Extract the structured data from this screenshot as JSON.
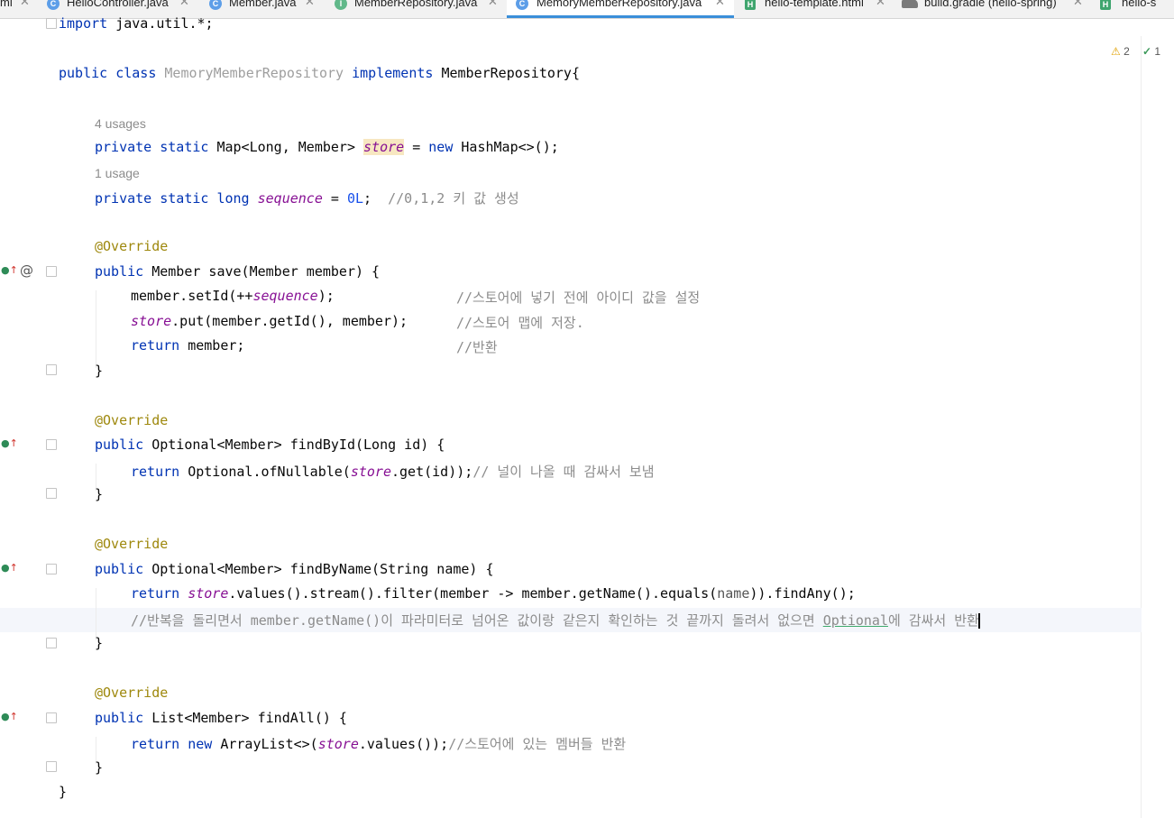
{
  "tabs": [
    {
      "label": "ml",
      "icon": "xml-file-icon",
      "active": false
    },
    {
      "label": "HelloController.java",
      "icon": "class-icon",
      "active": false
    },
    {
      "label": "Member.java",
      "icon": "class-icon",
      "active": false
    },
    {
      "label": "MemberRepository.java",
      "icon": "interface-icon",
      "active": false
    },
    {
      "label": "MemoryMemberRepository.java",
      "icon": "class-icon",
      "active": true
    },
    {
      "label": "hello-template.html",
      "icon": "html-file-icon",
      "active": false
    },
    {
      "label": "build.gradle (hello-spring)",
      "icon": "gradle-icon",
      "active": false
    },
    {
      "label": "hello-s",
      "icon": "html-file-icon",
      "active": false
    }
  ],
  "inspections": {
    "warnings": "2",
    "ok": "1"
  },
  "code": {
    "import": {
      "kw": "import",
      "rest": " java.util.*;"
    },
    "class_decl": {
      "kw1": "public",
      "kw2": "class",
      "name": "MemoryMemberRepository",
      "kw3": "implements",
      "iface": "MemberRepository{"
    },
    "usages_store": "4 usages",
    "store_decl": {
      "kw": "private static",
      "type": " Map<Long, Member> ",
      "field": "store",
      "eq": " = ",
      "kw2": "new",
      "rest": " HashMap<>();"
    },
    "usages_seq": "1 usage",
    "seq_decl": {
      "kw": "private static long",
      "field": "sequence",
      "eq": " = ",
      "num": "0L",
      "semi": ";  ",
      "comment": "//0,1,2 키 값 생성"
    },
    "override": "@Override",
    "save_sig": {
      "kw": "public",
      "rest": " Member save(Member member) {"
    },
    "save_l1": {
      "a": "member.setId(++",
      "field": "sequence",
      "b": ");",
      "comment": "//스토어에 넣기 전에 아이디 값을 설정"
    },
    "save_l2": {
      "field": "store",
      "b": ".put(member.getId(), member);",
      "comment": "//스토어 맵에 저장."
    },
    "save_l3": {
      "kw": "return",
      "b": " member;",
      "comment": "//반환"
    },
    "close_brace": "}",
    "findById_sig": {
      "kw": "public",
      "rest": " Optional<Member> findById(Long id) {"
    },
    "findById_l1": {
      "kw": "return",
      "a": " Optional.ofNullable(",
      "field": "store",
      "b": ".get(id));",
      "comment": "// 널이 나올 때 감싸서 보냄"
    },
    "findByName_sig": {
      "kw": "public",
      "rest": " Optional<Member> findByName(String name) {"
    },
    "findByName_l1": {
      "kw": "return",
      "field": "store",
      "a": ".values().stream().filter(member -> member.getName().equals(",
      "param": "name",
      "b": ")).findAny();"
    },
    "findByName_l2": {
      "comment_a": "//반복을 돌리면서 member.getName()이 파라미터로 넘어온 값이랑 같은지 확인하는 것 끝까지 돌려서 없으면 ",
      "comment_u": "Optional",
      "comment_b": "에 감싸서 반환"
    },
    "findAll_sig": {
      "kw": "public",
      "rest": " List<Member> findAll() {"
    },
    "findAll_l1": {
      "kw": "return",
      "kw2": "new",
      "a": " ArrayList<>(",
      "field": "store",
      "b": ".values());",
      "comment": "//스토어에 있는 멤버들 반환"
    },
    "class_close": "}"
  }
}
